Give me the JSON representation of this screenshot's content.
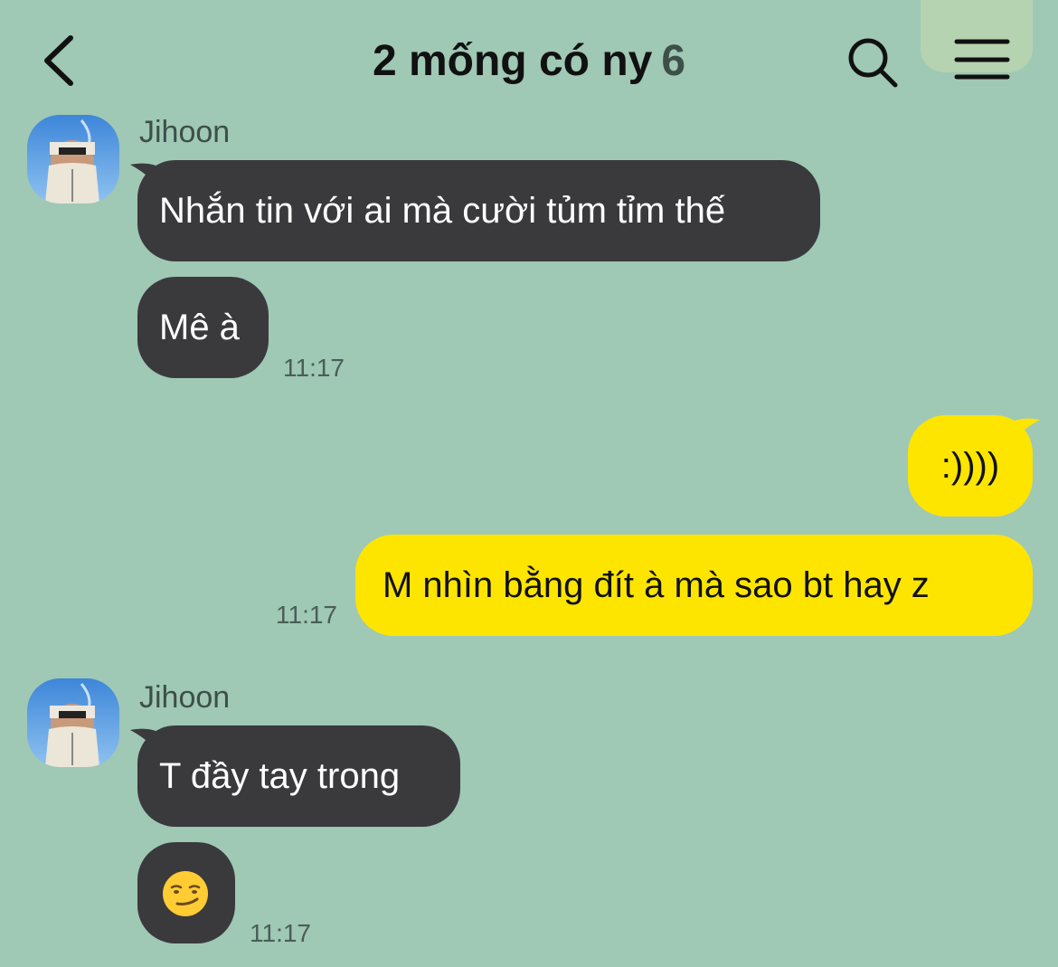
{
  "header": {
    "title": "2 mống có ny",
    "member_count": "6"
  },
  "colors": {
    "background": "#9fc8b5",
    "incoming_bubble": "#3a3a3c",
    "outgoing_bubble": "#fee500"
  },
  "icons": {
    "back": "chevron-left-icon",
    "search": "search-icon",
    "menu": "hamburger-menu-icon"
  },
  "messages": {
    "group1": {
      "sender": "Jihoon",
      "bubble1": "Nhắn tin với ai mà cười tủm tỉm thế",
      "bubble2": "Mê à",
      "time": "11:17"
    },
    "group2": {
      "bubble1": ":))))",
      "bubble2": "M nhìn bằng đít à mà sao bt hay z",
      "time": "11:17"
    },
    "group3": {
      "sender": "Jihoon",
      "bubble1": "T đầy tay trong",
      "bubble2": "😏",
      "time": "11:17"
    }
  }
}
